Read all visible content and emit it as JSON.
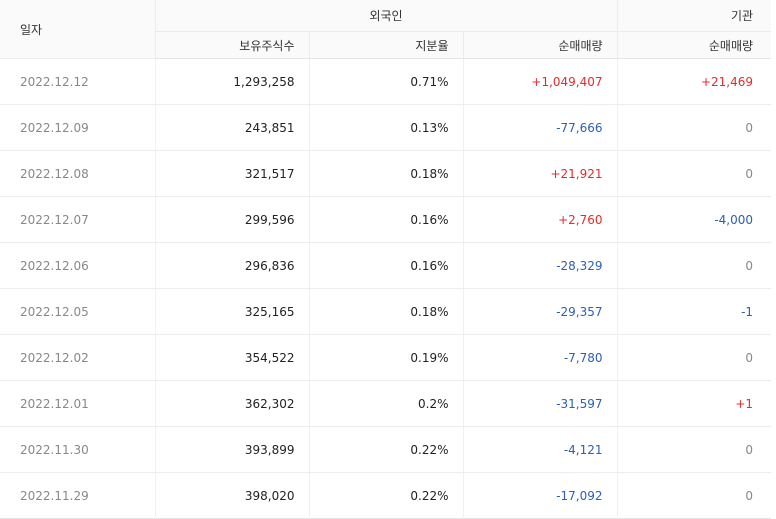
{
  "header": {
    "date": "일자",
    "foreign": "외국인",
    "institution": "기관",
    "holdings": "보유주식수",
    "ratio": "지분율",
    "foreign_net": "순매매량",
    "institution_net": "순매매량"
  },
  "colors": {
    "positive": "#e82a2a",
    "negative": "#2b5fb5",
    "zero": "#888888"
  },
  "rows": [
    {
      "date": "2022.12.12",
      "holdings": "1,293,258",
      "ratio": "0.71%",
      "foreign_net": "+1,049,407",
      "inst_net": "+21,469"
    },
    {
      "date": "2022.12.09",
      "holdings": "243,851",
      "ratio": "0.13%",
      "foreign_net": "-77,666",
      "inst_net": "0"
    },
    {
      "date": "2022.12.08",
      "holdings": "321,517",
      "ratio": "0.18%",
      "foreign_net": "+21,921",
      "inst_net": "0"
    },
    {
      "date": "2022.12.07",
      "holdings": "299,596",
      "ratio": "0.16%",
      "foreign_net": "+2,760",
      "inst_net": "-4,000"
    },
    {
      "date": "2022.12.06",
      "holdings": "296,836",
      "ratio": "0.16%",
      "foreign_net": "-28,329",
      "inst_net": "0"
    },
    {
      "date": "2022.12.05",
      "holdings": "325,165",
      "ratio": "0.18%",
      "foreign_net": "-29,357",
      "inst_net": "-1"
    },
    {
      "date": "2022.12.02",
      "holdings": "354,522",
      "ratio": "0.19%",
      "foreign_net": "-7,780",
      "inst_net": "0"
    },
    {
      "date": "2022.12.01",
      "holdings": "362,302",
      "ratio": "0.2%",
      "foreign_net": "-31,597",
      "inst_net": "+1"
    },
    {
      "date": "2022.11.30",
      "holdings": "393,899",
      "ratio": "0.22%",
      "foreign_net": "-4,121",
      "inst_net": "0"
    },
    {
      "date": "2022.11.29",
      "holdings": "398,020",
      "ratio": "0.22%",
      "foreign_net": "-17,092",
      "inst_net": "0"
    }
  ]
}
